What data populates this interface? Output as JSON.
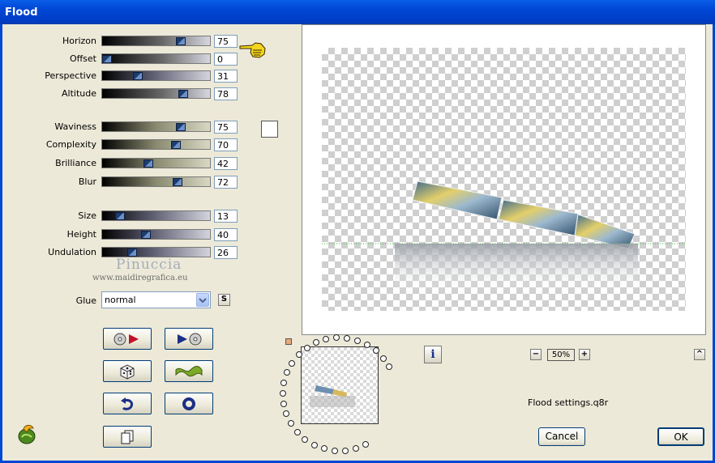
{
  "window": {
    "title": "Flood"
  },
  "sliders": [
    {
      "label": "Horizon",
      "value": "75",
      "level": 0.75
    },
    {
      "label": "Offset",
      "value": "0",
      "level": 0.0
    },
    {
      "label": "Perspective",
      "value": "31",
      "level": 0.31
    },
    {
      "label": "Altitude",
      "value": "78",
      "level": 0.78
    },
    {
      "label": "Waviness",
      "value": "75",
      "level": 0.75
    },
    {
      "label": "Complexity",
      "value": "70",
      "level": 0.7
    },
    {
      "label": "Brilliance",
      "value": "42",
      "level": 0.42
    },
    {
      "label": "Blur",
      "value": "72",
      "level": 0.72
    },
    {
      "label": "Size",
      "value": "13",
      "level": 0.13
    },
    {
      "label": "Height",
      "value": "40",
      "level": 0.4
    },
    {
      "label": "Undulation",
      "value": "26",
      "level": 0.26
    }
  ],
  "watermark": {
    "name": "Pinuccia",
    "url": "www.maidiregrafica.eu"
  },
  "glue": {
    "label": "Glue",
    "value": "normal",
    "s_button": "S"
  },
  "preview": {
    "zoom": "50%",
    "zoom_minus": "−",
    "zoom_plus": "+",
    "settings_file": "Flood settings.q8r"
  },
  "buttons": {
    "cancel": "Cancel",
    "ok": "OK",
    "info": "i",
    "up": "^"
  },
  "colors": {
    "accent": "#0046d5",
    "slider_thumb": "#1d3c6e"
  }
}
